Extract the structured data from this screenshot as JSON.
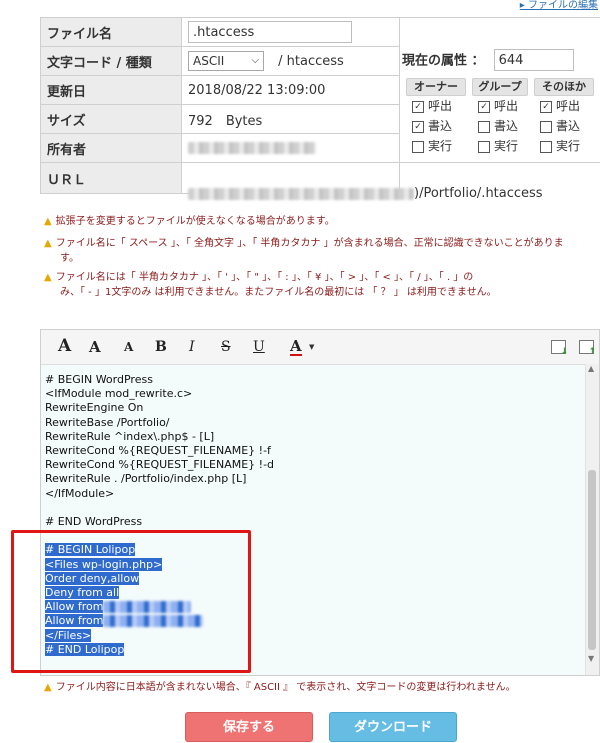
{
  "top_link": "ファイルの編集",
  "file_table": [
    {
      "label": "ファイル名",
      "value": ".htaccess"
    },
    {
      "label": "文字コード / 種類",
      "encoding": "ASCII",
      "type": "/ htaccess"
    },
    {
      "label": "更新日",
      "value": "2018/08/22 13:09:00"
    },
    {
      "label": "サイズ",
      "value": "792　Bytes"
    },
    {
      "label": "所有者"
    },
    {
      "label": "ＵＲＬ",
      "url_suffix": ")/Portfolio/.htaccess"
    }
  ],
  "permissions": {
    "title": "現在の属性 ：",
    "value": "644",
    "headers": [
      "オーナー",
      "グループ",
      "そのほか"
    ],
    "rows": [
      {
        "label": "呼出",
        "states": [
          true,
          true,
          true
        ]
      },
      {
        "label": "書込",
        "states": [
          true,
          false,
          false
        ]
      },
      {
        "label": "実行",
        "states": [
          false,
          false,
          false
        ]
      }
    ]
  },
  "warnings": [
    "拡張子を変更するとファイルが使えなくなる場合があります。",
    "ファイル名に「 スペース 」、「 全角文字 」、「 半角カタカナ 」が含まれる場合、正常に認識できないことがありま",
    "す。",
    "ファイル名には「 半角カタカナ 」、「 ' 」、「 \" 」、「 : 」、「 ¥ 」、「 > 」、「 < 」、「 / 」、「 . 」の",
    "み、「 - 」1文字のみ は利用できません。またファイル名の最初には 「 ？ 」 は利用できません。"
  ],
  "toolbar": {
    "font_large": "A",
    "font_medium": "A",
    "font_small": "A",
    "bold": "B",
    "italic": "I",
    "strike": "S",
    "underline": "U",
    "color": "A"
  },
  "code_lines": [
    "# BEGIN WordPress",
    "<IfModule mod_rewrite.c>",
    "RewriteEngine On",
    "RewriteBase /Portfolio/",
    "RewriteRule ^index\\.php$ - [L]",
    "RewriteCond %{REQUEST_FILENAME} !-f",
    "RewriteCond %{REQUEST_FILENAME} !-d",
    "RewriteRule . /Portfolio/index.php [L]",
    "</IfModule>",
    "",
    "# END WordPress",
    "",
    "# BEGIN Lolipop",
    "<Files wp-login.php>",
    "Order deny,allow",
    "Deny from all",
    "Allow from",
    "Allow from",
    "</Files>",
    "# END Lolipop"
  ],
  "bottom_note": "ファイル内容に日本語が含まれない場合、『 ASCII 』 で表示され、文字コードの変更は行われません。",
  "buttons": {
    "save": "保存する",
    "download": "ダウンロード"
  },
  "colors": {
    "save": "#f07373",
    "download": "#66bde3",
    "selection": "#2f6bcf",
    "warning_text": "#8b1a1a",
    "highlight_box": "#e01616"
  }
}
